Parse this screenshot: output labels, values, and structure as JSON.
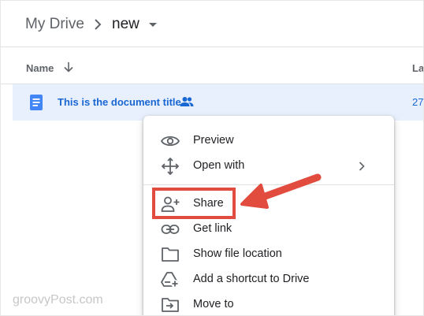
{
  "breadcrumb": {
    "root_label": "My Drive",
    "current_folder": "new"
  },
  "columns": {
    "name_label": "Name",
    "last_label": "La"
  },
  "file": {
    "title": "This is the document title",
    "date_fragment": "27",
    "shared": true
  },
  "menu": {
    "items": [
      {
        "label": "Preview",
        "icon": "eye-icon"
      },
      {
        "label": "Open with",
        "icon": "move-arrows-icon",
        "has_submenu": true
      },
      {
        "label": "Share",
        "icon": "person-add-icon",
        "highlighted": true
      },
      {
        "label": "Get link",
        "icon": "link-icon"
      },
      {
        "label": "Show file location",
        "icon": "folder-icon"
      },
      {
        "label": "Add a shortcut to Drive",
        "icon": "add-shortcut-icon"
      },
      {
        "label": "Move to",
        "icon": "move-to-folder-icon"
      }
    ]
  },
  "colors": {
    "selected_row_bg": "#e8f0fe",
    "link_blue": "#1967d2",
    "annotation_red": "#e24c3e",
    "doc_icon_blue": "#4285f4"
  },
  "watermark": "groovyPost.com"
}
